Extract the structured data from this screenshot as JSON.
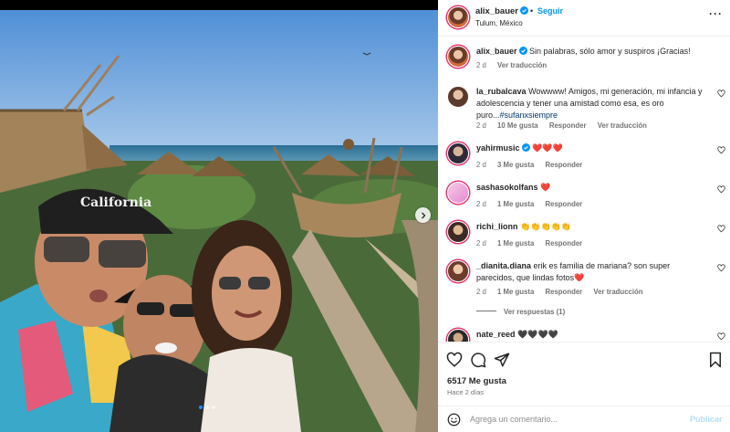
{
  "post": {
    "username": "alix_bauer",
    "follow_label": "Seguir",
    "separator": "•",
    "location": "Tulum, México",
    "more_label": "···",
    "image_semantic": "selfie-photo",
    "carousel_dots": 3,
    "carousel_active": 1
  },
  "caption": {
    "username": "alix_bauer",
    "text": "Sin palabras, sólo amor y suspiros ¡Gracias!",
    "time": "2 d",
    "translate": "Ver traducción"
  },
  "comments": [
    {
      "username": "la_rubalcava",
      "text": "Wowwww! Amigos, mi generación, mi infancia y adolescencia y tener una amistad como esa, es oro puro...",
      "hashtag": "#sufanxsiempre",
      "time": "2 d",
      "likes": "10 Me gusta",
      "reply": "Responder",
      "translate": "Ver traducción"
    },
    {
      "username": "yahirmusic",
      "text": "❤️❤️❤️",
      "time": "2 d",
      "likes": "3 Me gusta",
      "reply": "Responder"
    },
    {
      "username": "sashasokolfans",
      "text": "❤️",
      "time": "2 d",
      "likes": "1 Me gusta",
      "reply": "Responder"
    },
    {
      "username": "richi_lionn",
      "text": "👏👏👏👏👏",
      "time": "2 d",
      "likes": "1 Me gusta",
      "reply": "Responder"
    },
    {
      "username": "_dianita.diana",
      "text": "erik es familia de mariana? son super parecidos, que lindas fotos❤️",
      "time": "2 d",
      "likes": "1 Me gusta",
      "reply": "Responder",
      "translate": "Ver traducción",
      "view_replies": "Ver respuestas (1)"
    },
    {
      "username": "nate_reed",
      "text": "🖤🖤🖤🖤",
      "time": "",
      "likes": "",
      "reply": ""
    }
  ],
  "actions": {
    "likes_count": "6517 Me gusta",
    "posted_ago": "Hace 2 días"
  },
  "add_comment": {
    "placeholder": "Agrega un comentario...",
    "publish_label": "Publicar"
  },
  "colors": {
    "accent": "#0095f6",
    "publish_disabled": "#b2dffc",
    "secondary_text": "#737373",
    "hashtag": "#00376b"
  }
}
